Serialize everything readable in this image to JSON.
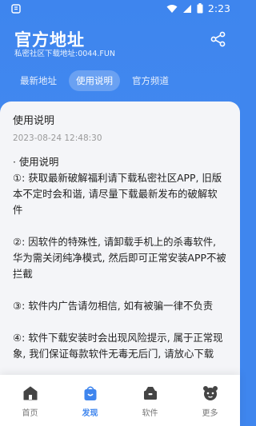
{
  "status_bar": {
    "time": "2:23"
  },
  "header": {
    "title": "官方地址",
    "subtitle": "私密社区下载地址:0044.FUN"
  },
  "tabs": [
    {
      "label": "最新地址",
      "active": false
    },
    {
      "label": "使用说明",
      "active": true
    },
    {
      "label": "官方频道",
      "active": false
    }
  ],
  "post": {
    "title": "使用说明",
    "date": "2023-08-24 12:48:30",
    "body": "· 使用说明\n①: 获取最新破解福利请下载私密社区APP, 旧版本不定时会和谐, 请尽量下载最新发布的破解软件\n\n②: 因软件的特殊性, 请卸载手机上的杀毒软件, 华为需关闭纯净模式, 然后即可正常安装APP不被拦截\n\n③: 软件内广告请勿相信, 如有被骗一律不负责\n\n④: 软件下载安装时会出现风险提示, 属于正常现象, 我们保证每款软件无毒无后门, 请放心下载"
  },
  "bottom_nav": [
    {
      "label": "首页",
      "icon": "home-icon",
      "active": false
    },
    {
      "label": "发现",
      "icon": "bag-icon",
      "active": true
    },
    {
      "label": "软件",
      "icon": "package-icon",
      "active": false
    },
    {
      "label": "更多",
      "icon": "more-icon",
      "active": false
    }
  ],
  "colors": {
    "brand": "#3e85ee",
    "card_bg": "#f4f5f8"
  }
}
